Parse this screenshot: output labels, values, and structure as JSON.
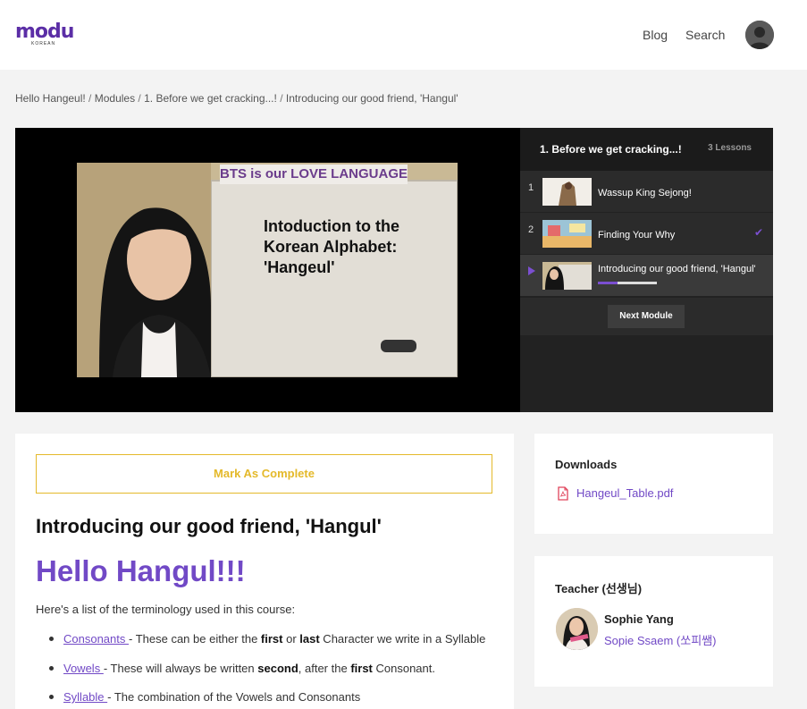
{
  "header": {
    "logo_text": "modu",
    "logo_sub": "KOREAN",
    "nav": {
      "blog": "Blog",
      "search": "Search"
    }
  },
  "breadcrumb": [
    "Hello Hangeul!",
    "Modules",
    "1. Before we get cracking...!",
    "Introducing our good friend, 'Hangul'"
  ],
  "video": {
    "banner": "BTS is our LOVE LANGUAGE",
    "overlay_title": "Intoduction to the\nKorean Alphabet:\n'Hangeul'"
  },
  "playlist": {
    "module_title": "1. Before we get cracking...!",
    "lesson_count": "3 Lessons",
    "lessons": [
      {
        "num": "1",
        "title": "Wassup King Sejong!",
        "completed": false,
        "active": false
      },
      {
        "num": "2",
        "title": "Finding Your Why",
        "completed": true,
        "active": false
      },
      {
        "num": "3",
        "title": "Introducing our good friend, 'Hangul'",
        "completed": false,
        "active": true,
        "progress": 0.33
      }
    ],
    "next_button": "Next Module",
    "accent_color": "#7149c6"
  },
  "lesson": {
    "complete_button": "Mark As Complete",
    "title": "Introducing our good friend, 'Hangul'",
    "heading": "Hello Hangul!!!",
    "intro": "Here's a list of the terminology used in this course:",
    "terms": [
      {
        "term": "Consonants ",
        "parts": [
          " - These can be either the ",
          "first",
          " or ",
          "last",
          " Character we write in a Syllable"
        ]
      },
      {
        "term": "Vowels ",
        "parts": [
          " - These will always be written ",
          "second",
          ", after the ",
          "first",
          " Consonant."
        ]
      },
      {
        "term": "Syllable ",
        "parts": [
          " - The combination of the Vowels and Consonants"
        ]
      }
    ]
  },
  "downloads": {
    "heading": "Downloads",
    "file": "Hangeul_Table.pdf",
    "icon": "pdf-file-icon"
  },
  "teacher": {
    "heading": "Teacher (선생님)",
    "name": "Sophie Yang",
    "nickname": "Sopie Ssaem (쏘피쌤)"
  }
}
